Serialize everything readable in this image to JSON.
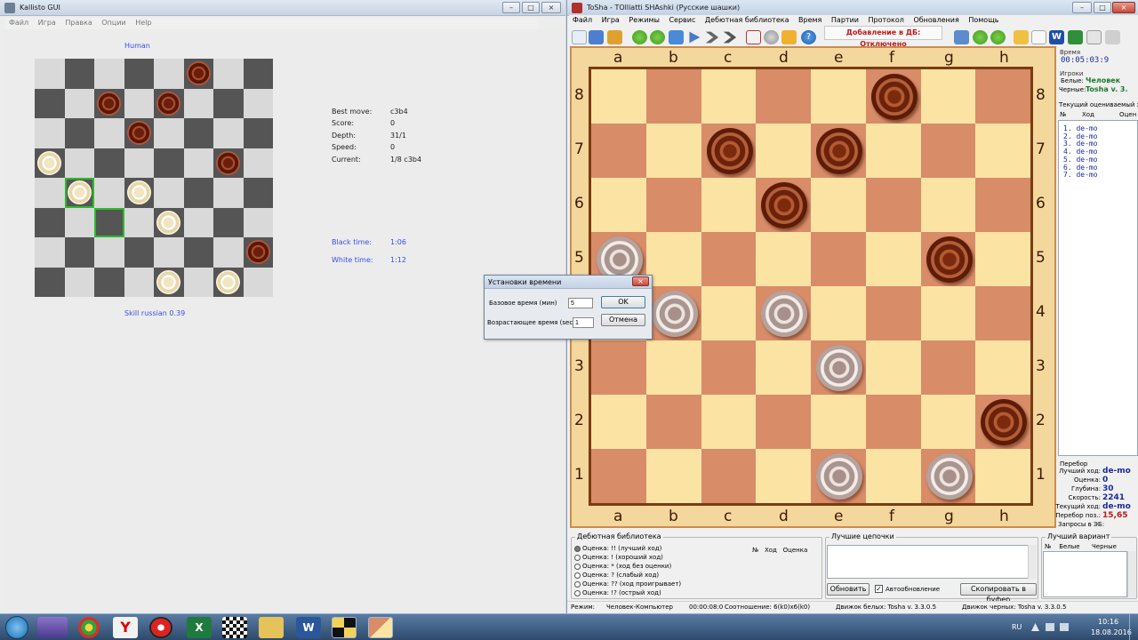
{
  "kallisto": {
    "title": "Kallisto GUI",
    "menu": [
      "Файл",
      "Игра",
      "Правка",
      "Опции",
      "Help"
    ],
    "top_player": "Human",
    "bottom_player": "Skill russian 0.39",
    "board": [
      [
        "",
        "",
        "",
        "",
        "",
        "b",
        "",
        ""
      ],
      [
        "",
        "",
        "b",
        "",
        "b",
        "",
        "",
        ""
      ],
      [
        "",
        "",
        "",
        "b",
        "",
        "",
        "",
        ""
      ],
      [
        "w",
        "",
        "",
        "",
        "",
        "",
        "b",
        ""
      ],
      [
        "",
        "w",
        "",
        "w",
        "",
        "",
        "",
        ""
      ],
      [
        "",
        "",
        "",
        "",
        "w",
        "",
        "",
        ""
      ],
      [
        "",
        "",
        "",
        "",
        "",
        "",
        "",
        "b"
      ],
      [
        "",
        "",
        "",
        "",
        "w",
        "",
        "w",
        ""
      ]
    ],
    "stats": {
      "best_move_label": "Best move:",
      "best_move": "c3b4",
      "score_label": "Score:",
      "score": "0",
      "depth_label": "Depth:",
      "depth": "31/1",
      "speed_label": "Speed:",
      "speed": "0",
      "current_label": "Current:",
      "current": "1/8 c3b4"
    },
    "black_time_label": "Black time:",
    "black_time": "1:06",
    "white_time_label": "White time:",
    "white_time": "1:12"
  },
  "tosha": {
    "title": "ToSha - TOlliatti SHAshki (Русские шашки)",
    "menu": [
      "Файл",
      "Игра",
      "Режимы",
      "Сервис",
      "Дебютная библиотека",
      "Время",
      "Партии",
      "Протокол",
      "Обновления",
      "Помощь"
    ],
    "db_status": "Добавление в ДБ: Отключено",
    "files": [
      "a",
      "b",
      "c",
      "d",
      "e",
      "f",
      "g",
      "h"
    ],
    "ranks": [
      "8",
      "7",
      "6",
      "5",
      "4",
      "3",
      "2",
      "1"
    ],
    "board": [
      [
        "",
        "",
        "",
        "",
        "",
        "b",
        "",
        ""
      ],
      [
        "",
        "",
        "b",
        "",
        "b",
        "",
        "",
        ""
      ],
      [
        "",
        "",
        "",
        "b",
        "",
        "",
        "",
        ""
      ],
      [
        "w",
        "",
        "",
        "",
        "",
        "",
        "b",
        ""
      ],
      [
        "",
        "w",
        "",
        "w",
        "",
        "",
        "",
        ""
      ],
      [
        "",
        "",
        "",
        "",
        "w",
        "",
        "",
        ""
      ],
      [
        "",
        "",
        "",
        "",
        "",
        "",
        "",
        "b"
      ],
      [
        "",
        "",
        "",
        "",
        "w",
        "",
        "w",
        ""
      ]
    ],
    "side": {
      "time_label": "Время",
      "time": "00:05:03:9",
      "games_label": "Игроки",
      "white_label": "Белые:",
      "white": "Человек",
      "black_label": "Черные:",
      "black": "Tosha v. 3.",
      "eval_label": "Текущий оцениваемый х",
      "eval_cols": [
        "№",
        "Ход",
        "Оцен"
      ],
      "eval_rows": [
        "1.  de-mo",
        "2.  de-mo",
        "3.  de-mo",
        "4.  de-mo",
        "5.  de-mo",
        "6.  de-mo",
        "7.  de-mo"
      ],
      "search_label": "Перебор",
      "best_label": "Лучший ход:",
      "best": "de-mo",
      "score_label": "Оценка:",
      "score": "0",
      "depth_label": "Глубина:",
      "depth": "30",
      "speed_label": "Скорость:",
      "speed": "2241",
      "cur_label": "Текущий ход:",
      "cur": "de-mo",
      "nodes_label": "Перебор поз.:",
      "nodes": "15,65",
      "db_label": "Запросы в ЭБ:"
    },
    "library": {
      "title": "Дебютная библиотека",
      "items": [
        "Оценка: !! (лучший ход)",
        "Оценка: ! (хороший ход)",
        "Оценка: * (ход без оценки)",
        "Оценка: ? (слабый ход)",
        "Оценка: ?? (ход проигрывает)",
        "Оценка: !? (острый ход)"
      ],
      "cols": [
        "№",
        "Ход",
        "Оценка"
      ]
    },
    "chains": {
      "title": "Лучшие цепочки",
      "refresh": "Обновить",
      "auto": "Автообновление",
      "copy": "Скопировать в буфер"
    },
    "variant": {
      "title": "Лучший вариант",
      "cols": [
        "№",
        "Белые",
        "Черные"
      ]
    },
    "status": {
      "mode_label": "Режим:",
      "mode": "Человек-Компьютер",
      "clock": "00:00:08:0",
      "ratio": "Соотношение: 6(k0)х6(k0)",
      "white_engine": "Движок белых: Tosha v. 3.3.0.5",
      "black_engine": "Движок черных: Tosha v. 3.3.0.5"
    }
  },
  "dialog": {
    "title": "Установки времени",
    "base_label": "Базовое время (мин)",
    "base_value": "5",
    "inc_label": "Возрастающее время (sec)",
    "inc_value": "1",
    "ok": "OK",
    "cancel": "Отмена"
  },
  "taskbar": {
    "lang": "RU",
    "time": "10:16",
    "date": "18.08.2016"
  }
}
